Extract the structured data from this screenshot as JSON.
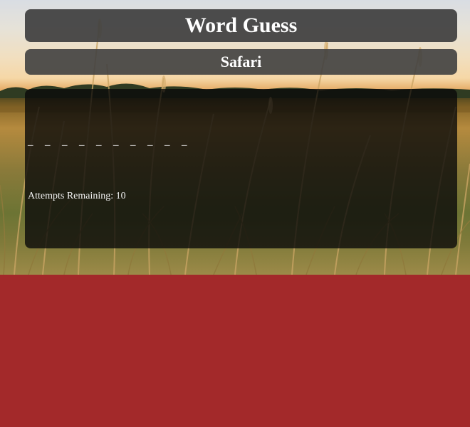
{
  "game": {
    "title": "Word Guess",
    "category": "Safari",
    "word_slots": [
      "_",
      "_",
      "_",
      "_",
      "_",
      "_",
      "_",
      "_",
      "_",
      "_"
    ],
    "attempts_label": "Attempts Remaining:",
    "attempts_remaining": "10"
  },
  "colors": {
    "page_background": "#a3292a",
    "panel": "#404040",
    "text": "#ffffff"
  }
}
